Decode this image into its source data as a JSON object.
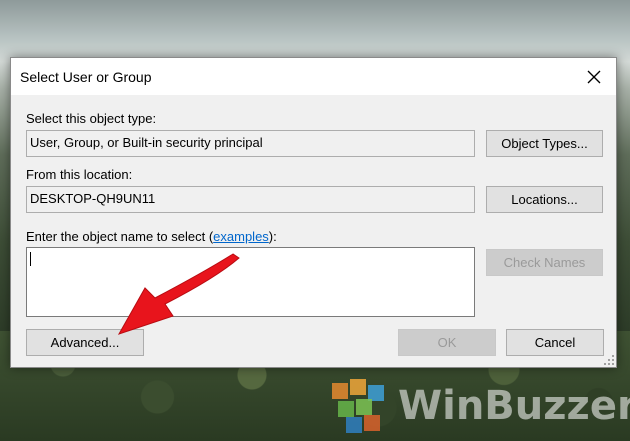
{
  "dialog": {
    "title": "Select User or Group",
    "object_type": {
      "label": "Select this object type:",
      "value": "User, Group, or Built-in security principal",
      "button": "Object Types..."
    },
    "location": {
      "label": "From this location:",
      "value": "DESKTOP-QH9UN11",
      "button": "Locations..."
    },
    "object_name": {
      "label_prefix": "Enter the object name to select (",
      "link": "examples",
      "label_suffix": "):",
      "value": "",
      "check_button": "Check Names"
    },
    "buttons": {
      "advanced": "Advanced...",
      "ok": "OK",
      "cancel": "Cancel"
    }
  },
  "watermark": {
    "text": "WinBuzzer"
  },
  "colors": {
    "arrow": "#e8141c",
    "link": "#0066cc"
  }
}
